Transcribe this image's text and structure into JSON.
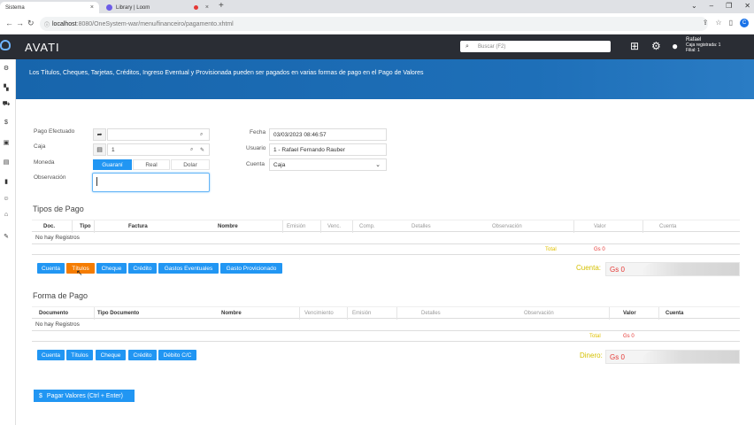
{
  "browser": {
    "tabs": [
      {
        "label": "Sistema",
        "active": true
      },
      {
        "label": "Library | Loom",
        "active": false
      }
    ],
    "url_host": "localhost",
    "url_path": ":8080/OneSystem-war/menu/financeiro/pagamento.xhtml"
  },
  "app": {
    "logo": "AVATI",
    "search_placeholder": "Buscar (F2)",
    "user": {
      "name": "Rafael",
      "caja": "Caja registrada: 1",
      "filial": "Filial: 1"
    }
  },
  "banner": {
    "text": "Los Títulos, Cheques, Tarjetas, Créditos, Ingreso Eventual y Provisionada pueden ser pagados en varias formas de pago en el Pago de Valores"
  },
  "form": {
    "pago_efectuado_label": "Pago Efectuado",
    "caja_label": "Caja",
    "caja_value": "1",
    "moneda_label": "Moneda",
    "moneda_options": [
      "Guaraní",
      "Real",
      "Dolar"
    ],
    "moneda_selected": "Guaraní",
    "observacion_label": "Observación",
    "fecha_label": "Fecha",
    "fecha_value": "03/03/2023 08:46:57",
    "usuario_label": "Usuario",
    "usuario_value": "1 - Rafael Fernando Rauber",
    "cuenta_label": "Cuenta",
    "cuenta_value": "Caja"
  },
  "tipos_pago": {
    "title": "Tipos de Pago",
    "columns": [
      "Doc.",
      "Tipo",
      "Factura",
      "Nombre",
      "Emisión",
      "Venc.",
      "Comp.",
      "Detalles",
      "Observación",
      "Valor",
      "Cuenta"
    ],
    "empty_text": "No hay Registros",
    "total_label": "Total",
    "total_value": "Gs 0",
    "buttons": [
      "Cuenta",
      "Títulos",
      "Cheque",
      "Crédito",
      "Gastos Eventuales",
      "Gasto Provicionado"
    ],
    "active_button": "Títulos",
    "cuenta_total_label": "Cuenta:",
    "cuenta_total_value": "Gs 0"
  },
  "forma_pago": {
    "title": "Forma de Pago",
    "columns": [
      "Documento",
      "Tipo Documento",
      "Nombre",
      "Vencimiento",
      "Emisión",
      "Detalles",
      "Observación",
      "Valor",
      "Cuenta"
    ],
    "empty_text": "No hay Registros",
    "total_label": "Total",
    "total_value": "Gs 0",
    "buttons": [
      "Cuenta",
      "Títulos",
      "Cheque",
      "Crédito",
      "Débito C/C"
    ],
    "dinero_label": "Dinero:",
    "dinero_value": "Gs 0"
  },
  "pay_button": {
    "icon": "$",
    "label": "Pagar Valores (Ctrl + Enter)"
  },
  "colors": {
    "primary": "#2196f3",
    "active": "#f57c00",
    "header": "#2a2d34",
    "banner": "#1765ac",
    "total": "#e53935"
  }
}
